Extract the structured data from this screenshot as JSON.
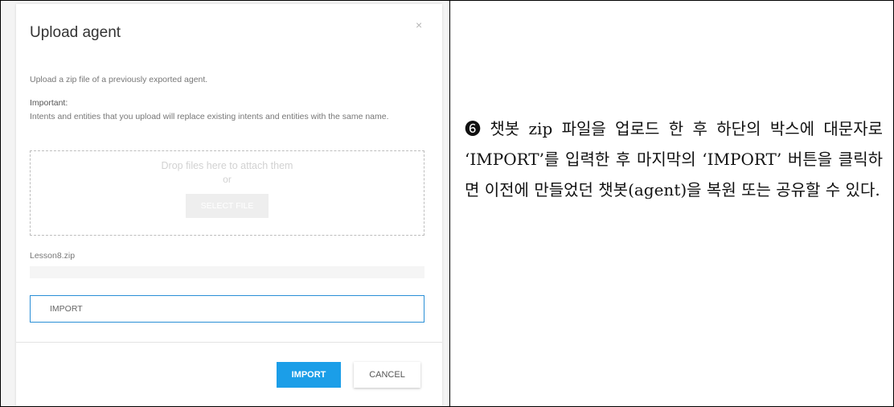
{
  "dialog": {
    "title": "Upload agent",
    "close_symbol": "×",
    "description": "Upload a zip file of a previously exported agent.",
    "important_label": "Important:",
    "important_text": "Intents and entities that you upload will replace existing intents and entities with the same name.",
    "dropzone_text": "Drop files here to attach them",
    "or_text": "or",
    "select_file_label": "SELECT FILE",
    "file_name": "Lesson8.zip",
    "confirm_input_value": "IMPORT",
    "import_label": "IMPORT",
    "cancel_label": "CANCEL"
  },
  "note": {
    "text": "➏ 챗봇 zip 파일을 업로드 한 후 하단의 박스에 대문자로 ‘IMPORT’를 입력한 후 마지막의 ‘IMPORT’ 버튼을 클릭하면 이전에 만들었던 챗봇(agent)을 복원 또는 공유할 수 있다."
  },
  "colors": {
    "accent": "#1b9ee8",
    "input_border": "#2a8fd6"
  },
  "icons": [
    "close-icon"
  ]
}
